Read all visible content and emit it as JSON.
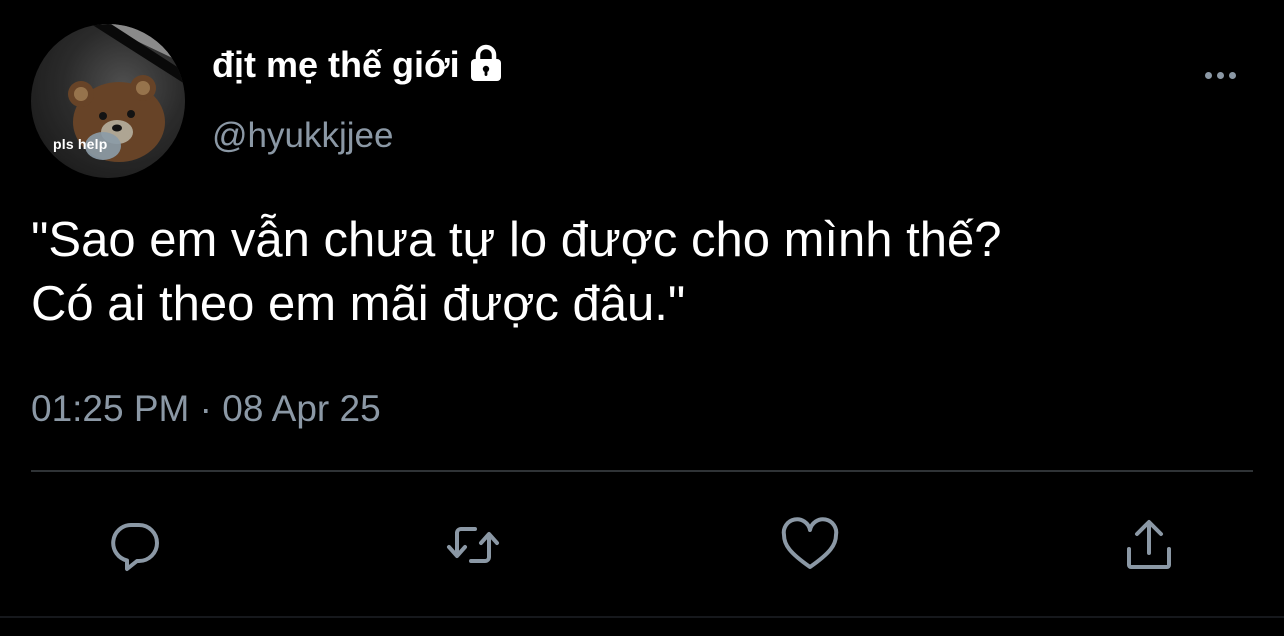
{
  "tweet": {
    "avatar_caption": "pls help",
    "display_name": "địt mẹ thế giới",
    "handle": "@hyukkjjee",
    "text_lines": [
      "\"Sao em vẫn chưa tự lo được cho mình thế?",
      "Có ai theo em mãi được đâu.\""
    ],
    "timestamp": "01:25 PM · 08 Apr 25"
  },
  "icons": {
    "lock": "lock-icon",
    "more": "more-horizontal-icon",
    "reply": "reply-bubble-icon",
    "retweet": "retweet-icon",
    "like": "heart-icon",
    "share": "share-upload-icon"
  },
  "colors": {
    "background": "#000000",
    "primary_text": "#ffffff",
    "secondary_text": "#8b98a5",
    "divider": "#2f3336"
  }
}
